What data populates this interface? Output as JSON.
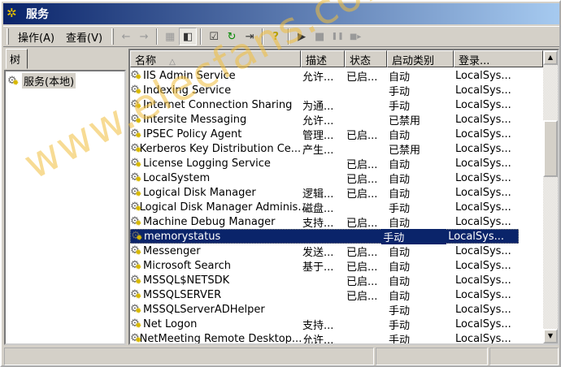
{
  "window": {
    "title": "服务"
  },
  "menu": [
    {
      "label": "操作(A)"
    },
    {
      "label": "查看(V)"
    }
  ],
  "toolbar": {
    "back": "←",
    "forward": "→",
    "up": "▦",
    "show_tree": "◧",
    "properties": "☑",
    "refresh": "↻",
    "export": "⇥",
    "help": "?",
    "start": "▶",
    "stop": "■",
    "pause": "❚❚",
    "restart": "■▸"
  },
  "left_pane": {
    "tab_label": "树",
    "tree_item": "服务(本地)"
  },
  "columns": [
    "名称",
    "描述",
    "状态",
    "启动类别",
    "登录..."
  ],
  "sort_indicator": "△",
  "services": [
    {
      "name": "IIS Admin Service",
      "desc": "允许...",
      "status": "已启...",
      "startup": "自动",
      "logon": "LocalSys..."
    },
    {
      "name": "Indexing Service",
      "desc": "",
      "status": "",
      "startup": "手动",
      "logon": "LocalSys..."
    },
    {
      "name": "Internet Connection Sharing",
      "desc": "为通...",
      "status": "",
      "startup": "手动",
      "logon": "LocalSys..."
    },
    {
      "name": "Intersite Messaging",
      "desc": "允许...",
      "status": "",
      "startup": "已禁用",
      "logon": "LocalSys..."
    },
    {
      "name": "IPSEC Policy Agent",
      "desc": "管理...",
      "status": "已启...",
      "startup": "自动",
      "logon": "LocalSys..."
    },
    {
      "name": "Kerberos Key Distribution Ce...",
      "desc": "产生...",
      "status": "",
      "startup": "已禁用",
      "logon": "LocalSys..."
    },
    {
      "name": "License Logging Service",
      "desc": "",
      "status": "已启...",
      "startup": "自动",
      "logon": "LocalSys..."
    },
    {
      "name": "LocalSystem",
      "desc": "",
      "status": "已启...",
      "startup": "自动",
      "logon": "LocalSys..."
    },
    {
      "name": "Logical Disk Manager",
      "desc": "逻辑...",
      "status": "已启...",
      "startup": "自动",
      "logon": "LocalSys..."
    },
    {
      "name": "Logical Disk Manager Adminis...",
      "desc": "磁盘...",
      "status": "",
      "startup": "手动",
      "logon": "LocalSys..."
    },
    {
      "name": "Machine Debug Manager",
      "desc": "支持...",
      "status": "已启...",
      "startup": "自动",
      "logon": "LocalSys..."
    },
    {
      "name": "memorystatus",
      "desc": "",
      "status": "",
      "startup": "手动",
      "logon": "LocalSys...",
      "selected": true
    },
    {
      "name": "Messenger",
      "desc": "发送...",
      "status": "已启...",
      "startup": "自动",
      "logon": "LocalSys..."
    },
    {
      "name": "Microsoft Search",
      "desc": "基于...",
      "status": "已启...",
      "startup": "自动",
      "logon": "LocalSys..."
    },
    {
      "name": "MSSQL$NETSDK",
      "desc": "",
      "status": "已启...",
      "startup": "自动",
      "logon": "LocalSys..."
    },
    {
      "name": "MSSQLSERVER",
      "desc": "",
      "status": "已启...",
      "startup": "自动",
      "logon": "LocalSys..."
    },
    {
      "name": "MSSQLServerADHelper",
      "desc": "",
      "status": "",
      "startup": "手动",
      "logon": "LocalSys..."
    },
    {
      "name": "Net Logon",
      "desc": "支持...",
      "status": "",
      "startup": "手动",
      "logon": "LocalSys..."
    },
    {
      "name": "NetMeeting Remote Desktop...",
      "desc": "允许...",
      "status": "",
      "startup": "手动",
      "logon": "LocalSys..."
    }
  ],
  "watermark": "www.elecfans.com"
}
